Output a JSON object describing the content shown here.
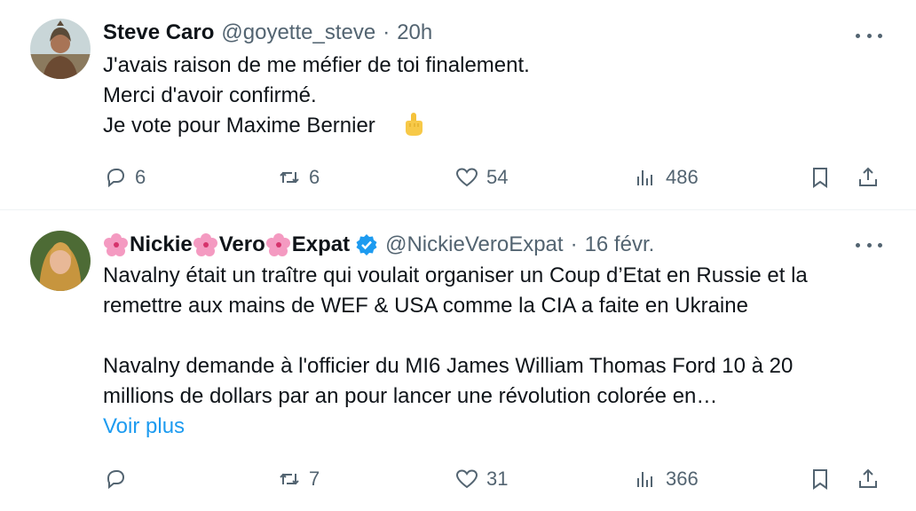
{
  "tweets": [
    {
      "author": {
        "name": "Steve Caro",
        "handle": "@goyette_steve",
        "time": "20h"
      },
      "lines": [
        "J'avais raison de me méfier de toi finalement.",
        "Merci d'avoir confirmé.",
        "Je vote pour Maxime Bernier"
      ],
      "emoji": "middle-finger-emoji",
      "stats": {
        "replies": "6",
        "reposts": "6",
        "likes": "54",
        "views": "486"
      }
    },
    {
      "author": {
        "name_parts": [
          "Nickie",
          "Vero",
          "Expat"
        ],
        "handle": "@NickieVeroExpat",
        "time": "16 févr.",
        "verified": true
      },
      "lines": [
        "Navalny était un traître qui voulait organiser un Coup d’Etat en Russie et la",
        "remettre aux mains de WEF & USA comme la CIA a faite en Ukraine",
        "Navalny demande à l'officier du MI6 James William Thomas Ford 10 à 20",
        "millions de dollars par an pour lancer une révolution colorée en…"
      ],
      "show_more": "Voir plus",
      "stats": {
        "replies": "",
        "reposts": "7",
        "likes": "31",
        "views": "366"
      }
    }
  ],
  "meta_separator": "·",
  "colors": {
    "text": "#0f1419",
    "secondary": "#536471",
    "link": "#1d9bf0",
    "verified": "#1d9bf0",
    "divider": "#eff3f4"
  }
}
